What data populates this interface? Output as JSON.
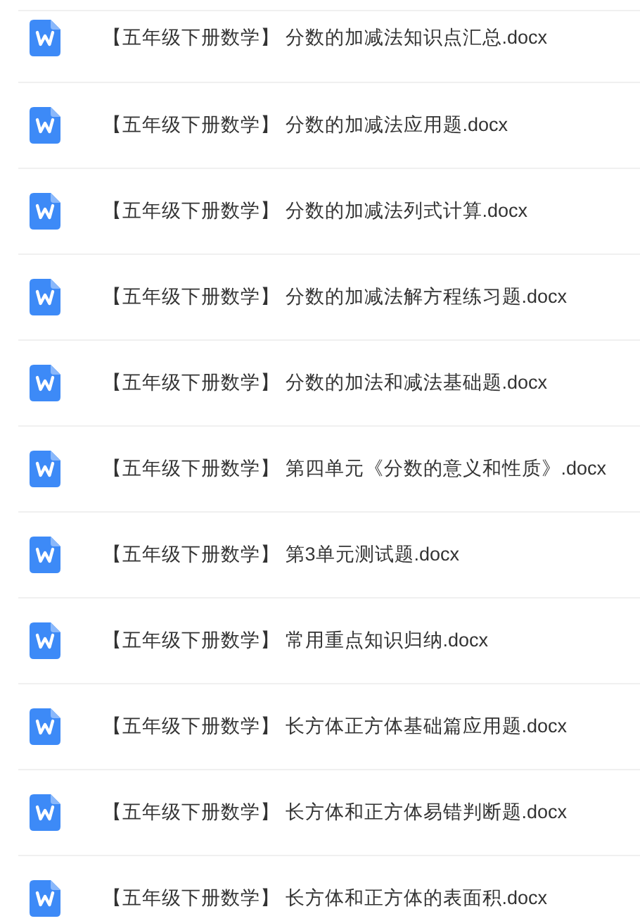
{
  "files": [
    {
      "name": "【五年级下册数学】 分数的加减法知识点汇总.docx"
    },
    {
      "name": "【五年级下册数学】 分数的加减法应用题.docx"
    },
    {
      "name": "【五年级下册数学】 分数的加减法列式计算.docx"
    },
    {
      "name": "【五年级下册数学】 分数的加减法解方程练习题.docx"
    },
    {
      "name": "【五年级下册数学】 分数的加法和减法基础题.docx"
    },
    {
      "name": "【五年级下册数学】 第四单元《分数的意义和性质》.docx"
    },
    {
      "name": "【五年级下册数学】 第3单元测试题.docx"
    },
    {
      "name": "【五年级下册数学】 常用重点知识归纳.docx"
    },
    {
      "name": "【五年级下册数学】 长方体正方体基础篇应用题.docx"
    },
    {
      "name": "【五年级下册数学】 长方体和正方体易错判断题.docx"
    },
    {
      "name": "【五年级下册数学】 长方体和正方体的表面积.docx"
    }
  ]
}
